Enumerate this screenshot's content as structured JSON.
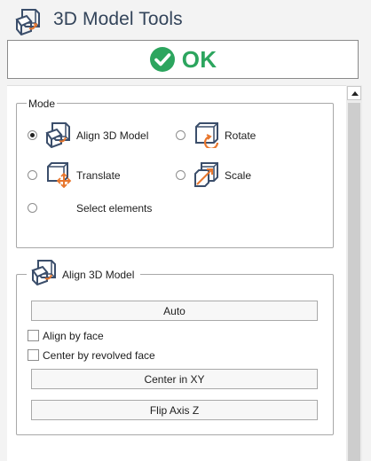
{
  "header": {
    "title": "3D Model Tools",
    "icon": "align-3d-model-icon"
  },
  "ok_button": {
    "label": "OK",
    "icon": "check-circle-icon",
    "color": "#2ca55e"
  },
  "mode": {
    "legend": "Mode",
    "selected": "align_3d_model",
    "options": [
      {
        "id": "align_3d_model",
        "label": "Align 3D Model",
        "icon": "align-3d-model-icon",
        "selected": true
      },
      {
        "id": "rotate",
        "label": "Rotate",
        "icon": "rotate-icon",
        "selected": false
      },
      {
        "id": "translate",
        "label": "Translate",
        "icon": "translate-icon",
        "selected": false
      },
      {
        "id": "scale",
        "label": "Scale",
        "icon": "scale-icon",
        "selected": false
      },
      {
        "id": "select_elements",
        "label": "Select elements",
        "selected": false
      }
    ]
  },
  "align_group": {
    "legend": "Align 3D Model",
    "icon": "align-3d-model-icon",
    "auto_button": "Auto",
    "align_by_face": {
      "label": "Align by face",
      "checked": false
    },
    "center_by_revolved_face": {
      "label": "Center by revolved face",
      "checked": false
    },
    "center_xy_button": "Center in XY",
    "flip_axis_button": "Flip Axis Z"
  },
  "colors": {
    "title_text": "#33445a",
    "icon_blue": "#3b4e6b",
    "icon_orange": "#e8772e",
    "ok_green": "#2ca55e"
  }
}
